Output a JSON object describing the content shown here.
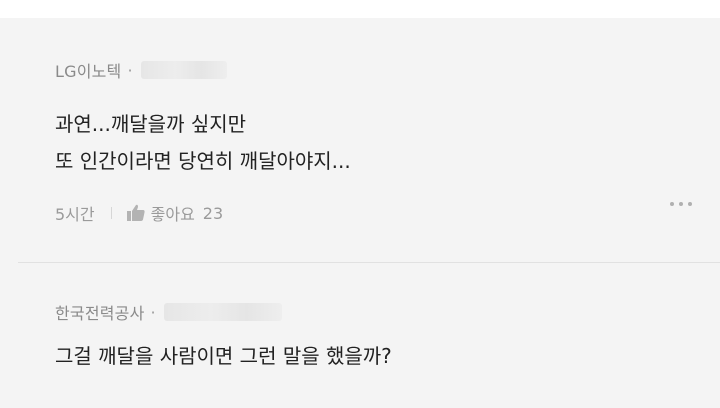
{
  "comments": [
    {
      "author": "LG이노텍",
      "dot": "·",
      "text": "과연...깨달을까 싶지만\n또 인간이라면 당연히 깨달아야지...",
      "time": "5시간",
      "like_label": "좋아요",
      "like_count": "23"
    },
    {
      "author": "한국전력공사",
      "dot": "·",
      "text": "그걸 깨달을 사람이면 그런 말을 했을까?"
    }
  ],
  "icons": {
    "like": "thumbs-up-icon",
    "more": "more-dots-icon"
  },
  "colors": {
    "background": "#f4f4f4",
    "text": "#222222",
    "meta": "#9a9a9a"
  }
}
